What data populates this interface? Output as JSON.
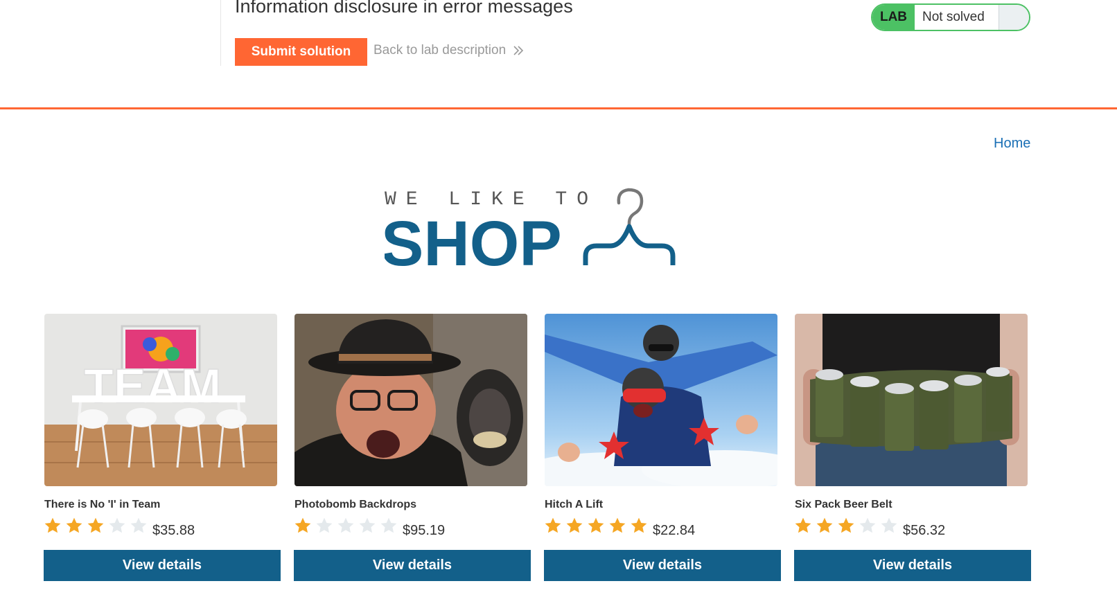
{
  "lab": {
    "title": "Information disclosure in error messages",
    "submit_label": "Submit solution",
    "back_label": "Back to lab description",
    "status_badge": "LAB",
    "status_text": "Not solved",
    "colors": {
      "accent": "#ff6633",
      "solved_green": "#4cc164"
    }
  },
  "shop": {
    "nav": {
      "home_label": "Home"
    },
    "logo": {
      "small_text": "WE LIKE TO",
      "big_text": "SHOP",
      "icon": "hanger-icon",
      "color": "#13608a"
    },
    "products": [
      {
        "name": "There is No 'I' in Team",
        "rating": 3,
        "max_rating": 5,
        "price": "$35.88",
        "button_label": "View details",
        "image": "team-room-photo"
      },
      {
        "name": "Photobomb Backdrops",
        "rating": 1,
        "max_rating": 5,
        "price": "$95.19",
        "button_label": "View details",
        "image": "monkey-photobomb-photo"
      },
      {
        "name": "Hitch A Lift",
        "rating": 5,
        "max_rating": 5,
        "price": "$22.84",
        "button_label": "View details",
        "image": "skydivers-photo"
      },
      {
        "name": "Six Pack Beer Belt",
        "rating": 3,
        "max_rating": 5,
        "price": "$56.32",
        "button_label": "View details",
        "image": "beer-belt-photo"
      }
    ]
  }
}
